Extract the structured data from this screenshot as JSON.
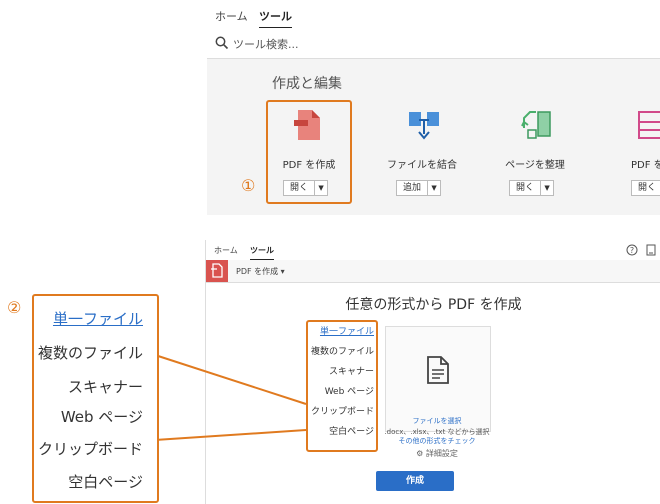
{
  "top": {
    "tabs": [
      "ホーム",
      "ツール"
    ],
    "search_placeholder": "ツール検索...",
    "section_title": "作成と編集",
    "tools": [
      {
        "name": "PDF を作成",
        "button": "開く"
      },
      {
        "name": "ファイルを結合",
        "button": "追加"
      },
      {
        "name": "ページを整理",
        "button": "開く"
      },
      {
        "name": "PDF を",
        "button": "開く"
      }
    ],
    "marker": "①"
  },
  "bottom": {
    "tabs": [
      "ホーム",
      "ツール"
    ],
    "breadcrumb": "PDF を作成 ▾",
    "heading": "任意の形式から PDF を作成",
    "options": [
      "単一ファイル",
      "複数のファイル",
      "スキャナー",
      "Web ページ",
      "クリップボード",
      "空白ページ"
    ],
    "select_file_link": "ファイルを選択",
    "select_file_sub": ".docx、.xlsx、.txt などから選択",
    "other_formats_link": "その他の形式をチェック",
    "details": "詳細設定",
    "create_button": "作成"
  },
  "callout": {
    "marker": "②",
    "options": [
      "単一ファイル",
      "複数のファイル",
      "スキャナー",
      "Web ページ",
      "クリップボード",
      "空白ページ"
    ]
  },
  "colors": {
    "accent": "#e07a1f",
    "link": "#2a6ec7",
    "adobe_red": "#d9534f"
  }
}
